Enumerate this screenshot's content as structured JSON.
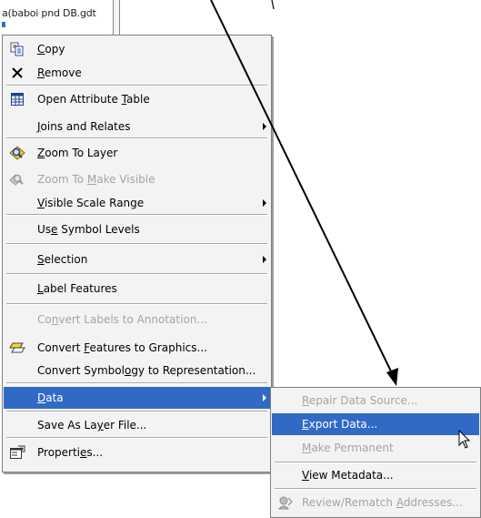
{
  "background": {
    "layer_name": "a(baboi pnd DB.gdt"
  },
  "context_menu": {
    "items": [
      {
        "label": "Copy",
        "mnemonic_index": 0,
        "icon": "copy-icon",
        "disabled": false
      },
      {
        "label": "Remove",
        "mnemonic_index": 0,
        "icon": "remove-x-icon",
        "disabled": false
      },
      {
        "label": "Open Attribute Table",
        "mnemonic_index": 15,
        "icon": "attribute-table-icon",
        "disabled": false
      },
      {
        "label": "Joins and Relates",
        "mnemonic_index": 0,
        "icon": "",
        "disabled": false,
        "submenu": true
      },
      {
        "label": "Zoom To Layer",
        "mnemonic_index": 0,
        "icon": "zoom-to-layer-icon",
        "disabled": false
      },
      {
        "label": "Zoom To Make Visible",
        "mnemonic_index": 8,
        "icon": "zoom-to-visible-icon",
        "disabled": true
      },
      {
        "label": "Visible Scale Range",
        "mnemonic_index": 0,
        "icon": "",
        "disabled": false,
        "submenu": true
      },
      {
        "label": "Use Symbol Levels",
        "mnemonic_index": 2,
        "icon": "",
        "disabled": false
      },
      {
        "label": "Selection",
        "mnemonic_index": 0,
        "icon": "",
        "disabled": false,
        "submenu": true
      },
      {
        "label": "Label Features",
        "mnemonic_index": 0,
        "icon": "",
        "disabled": false
      },
      {
        "label": "Convert Labels to Annotation...",
        "mnemonic_index": 2,
        "icon": "",
        "disabled": true
      },
      {
        "label": "Convert Features to Graphics...",
        "mnemonic_index": 8,
        "icon": "convert-graphics-icon",
        "disabled": false
      },
      {
        "label": "Convert Symbology to Representation...",
        "mnemonic_index": 14,
        "icon": "",
        "disabled": false
      },
      {
        "label": "Data",
        "mnemonic_index": 0,
        "icon": "",
        "disabled": false,
        "submenu": true,
        "highlighted": true
      },
      {
        "label": "Save As Layer File...",
        "mnemonic_index": 10,
        "icon": "",
        "disabled": false
      },
      {
        "label": "Properties...",
        "mnemonic_index": 8,
        "icon": "properties-icon",
        "disabled": false
      }
    ]
  },
  "data_submenu": {
    "items": [
      {
        "label": "Repair Data Source...",
        "mnemonic_index": 0,
        "disabled": true
      },
      {
        "label": "Export Data...",
        "mnemonic_index": 0,
        "disabled": false,
        "highlighted": true
      },
      {
        "label": "Make Permanent",
        "mnemonic_index": 0,
        "disabled": true
      },
      {
        "label": "View Metadata...",
        "mnemonic_index": 0,
        "disabled": false
      },
      {
        "label": "Review/Rematch Addresses...",
        "mnemonic_index": 15,
        "disabled": true,
        "icon": "review-rematch-icon"
      }
    ]
  },
  "colors": {
    "menu_bg": "#f3f3f3",
    "highlight": "#316ac5",
    "disabled_text": "#a4a4a4",
    "annotation_line": "#000000"
  }
}
